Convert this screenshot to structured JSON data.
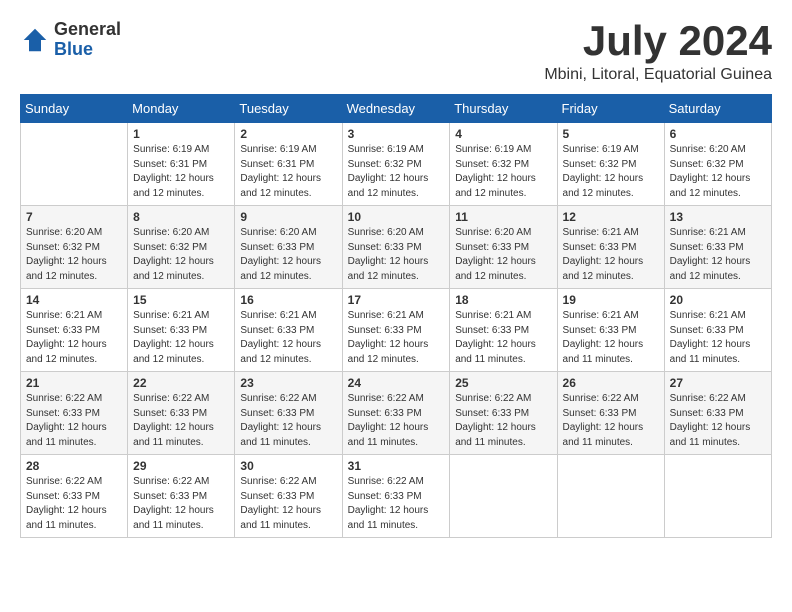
{
  "header": {
    "logo": {
      "general": "General",
      "blue": "Blue"
    },
    "title": "July 2024",
    "location": "Mbini, Litoral, Equatorial Guinea"
  },
  "weekdays": [
    "Sunday",
    "Monday",
    "Tuesday",
    "Wednesday",
    "Thursday",
    "Friday",
    "Saturday"
  ],
  "weeks": [
    [
      {
        "day": "",
        "sunrise": "",
        "sunset": "",
        "daylight": ""
      },
      {
        "day": "1",
        "sunrise": "Sunrise: 6:19 AM",
        "sunset": "Sunset: 6:31 PM",
        "daylight": "Daylight: 12 hours and 12 minutes."
      },
      {
        "day": "2",
        "sunrise": "Sunrise: 6:19 AM",
        "sunset": "Sunset: 6:31 PM",
        "daylight": "Daylight: 12 hours and 12 minutes."
      },
      {
        "day": "3",
        "sunrise": "Sunrise: 6:19 AM",
        "sunset": "Sunset: 6:32 PM",
        "daylight": "Daylight: 12 hours and 12 minutes."
      },
      {
        "day": "4",
        "sunrise": "Sunrise: 6:19 AM",
        "sunset": "Sunset: 6:32 PM",
        "daylight": "Daylight: 12 hours and 12 minutes."
      },
      {
        "day": "5",
        "sunrise": "Sunrise: 6:19 AM",
        "sunset": "Sunset: 6:32 PM",
        "daylight": "Daylight: 12 hours and 12 minutes."
      },
      {
        "day": "6",
        "sunrise": "Sunrise: 6:20 AM",
        "sunset": "Sunset: 6:32 PM",
        "daylight": "Daylight: 12 hours and 12 minutes."
      }
    ],
    [
      {
        "day": "7",
        "sunrise": "Sunrise: 6:20 AM",
        "sunset": "Sunset: 6:32 PM",
        "daylight": "Daylight: 12 hours and 12 minutes."
      },
      {
        "day": "8",
        "sunrise": "Sunrise: 6:20 AM",
        "sunset": "Sunset: 6:32 PM",
        "daylight": "Daylight: 12 hours and 12 minutes."
      },
      {
        "day": "9",
        "sunrise": "Sunrise: 6:20 AM",
        "sunset": "Sunset: 6:33 PM",
        "daylight": "Daylight: 12 hours and 12 minutes."
      },
      {
        "day": "10",
        "sunrise": "Sunrise: 6:20 AM",
        "sunset": "Sunset: 6:33 PM",
        "daylight": "Daylight: 12 hours and 12 minutes."
      },
      {
        "day": "11",
        "sunrise": "Sunrise: 6:20 AM",
        "sunset": "Sunset: 6:33 PM",
        "daylight": "Daylight: 12 hours and 12 minutes."
      },
      {
        "day": "12",
        "sunrise": "Sunrise: 6:21 AM",
        "sunset": "Sunset: 6:33 PM",
        "daylight": "Daylight: 12 hours and 12 minutes."
      },
      {
        "day": "13",
        "sunrise": "Sunrise: 6:21 AM",
        "sunset": "Sunset: 6:33 PM",
        "daylight": "Daylight: 12 hours and 12 minutes."
      }
    ],
    [
      {
        "day": "14",
        "sunrise": "Sunrise: 6:21 AM",
        "sunset": "Sunset: 6:33 PM",
        "daylight": "Daylight: 12 hours and 12 minutes."
      },
      {
        "day": "15",
        "sunrise": "Sunrise: 6:21 AM",
        "sunset": "Sunset: 6:33 PM",
        "daylight": "Daylight: 12 hours and 12 minutes."
      },
      {
        "day": "16",
        "sunrise": "Sunrise: 6:21 AM",
        "sunset": "Sunset: 6:33 PM",
        "daylight": "Daylight: 12 hours and 12 minutes."
      },
      {
        "day": "17",
        "sunrise": "Sunrise: 6:21 AM",
        "sunset": "Sunset: 6:33 PM",
        "daylight": "Daylight: 12 hours and 12 minutes."
      },
      {
        "day": "18",
        "sunrise": "Sunrise: 6:21 AM",
        "sunset": "Sunset: 6:33 PM",
        "daylight": "Daylight: 12 hours and 11 minutes."
      },
      {
        "day": "19",
        "sunrise": "Sunrise: 6:21 AM",
        "sunset": "Sunset: 6:33 PM",
        "daylight": "Daylight: 12 hours and 11 minutes."
      },
      {
        "day": "20",
        "sunrise": "Sunrise: 6:21 AM",
        "sunset": "Sunset: 6:33 PM",
        "daylight": "Daylight: 12 hours and 11 minutes."
      }
    ],
    [
      {
        "day": "21",
        "sunrise": "Sunrise: 6:22 AM",
        "sunset": "Sunset: 6:33 PM",
        "daylight": "Daylight: 12 hours and 11 minutes."
      },
      {
        "day": "22",
        "sunrise": "Sunrise: 6:22 AM",
        "sunset": "Sunset: 6:33 PM",
        "daylight": "Daylight: 12 hours and 11 minutes."
      },
      {
        "day": "23",
        "sunrise": "Sunrise: 6:22 AM",
        "sunset": "Sunset: 6:33 PM",
        "daylight": "Daylight: 12 hours and 11 minutes."
      },
      {
        "day": "24",
        "sunrise": "Sunrise: 6:22 AM",
        "sunset": "Sunset: 6:33 PM",
        "daylight": "Daylight: 12 hours and 11 minutes."
      },
      {
        "day": "25",
        "sunrise": "Sunrise: 6:22 AM",
        "sunset": "Sunset: 6:33 PM",
        "daylight": "Daylight: 12 hours and 11 minutes."
      },
      {
        "day": "26",
        "sunrise": "Sunrise: 6:22 AM",
        "sunset": "Sunset: 6:33 PM",
        "daylight": "Daylight: 12 hours and 11 minutes."
      },
      {
        "day": "27",
        "sunrise": "Sunrise: 6:22 AM",
        "sunset": "Sunset: 6:33 PM",
        "daylight": "Daylight: 12 hours and 11 minutes."
      }
    ],
    [
      {
        "day": "28",
        "sunrise": "Sunrise: 6:22 AM",
        "sunset": "Sunset: 6:33 PM",
        "daylight": "Daylight: 12 hours and 11 minutes."
      },
      {
        "day": "29",
        "sunrise": "Sunrise: 6:22 AM",
        "sunset": "Sunset: 6:33 PM",
        "daylight": "Daylight: 12 hours and 11 minutes."
      },
      {
        "day": "30",
        "sunrise": "Sunrise: 6:22 AM",
        "sunset": "Sunset: 6:33 PM",
        "daylight": "Daylight: 12 hours and 11 minutes."
      },
      {
        "day": "31",
        "sunrise": "Sunrise: 6:22 AM",
        "sunset": "Sunset: 6:33 PM",
        "daylight": "Daylight: 12 hours and 11 minutes."
      },
      {
        "day": "",
        "sunrise": "",
        "sunset": "",
        "daylight": ""
      },
      {
        "day": "",
        "sunrise": "",
        "sunset": "",
        "daylight": ""
      },
      {
        "day": "",
        "sunrise": "",
        "sunset": "",
        "daylight": ""
      }
    ]
  ]
}
